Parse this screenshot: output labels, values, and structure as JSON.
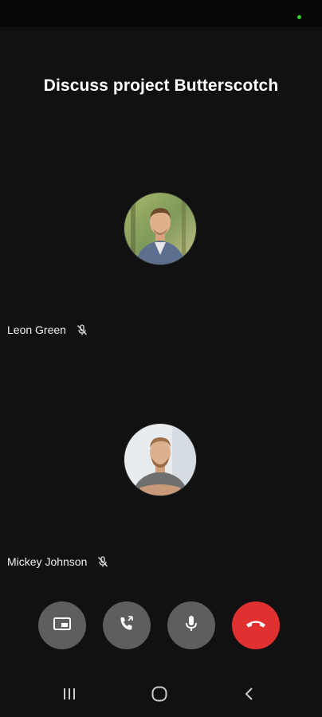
{
  "meeting": {
    "title": "Discuss project Butterscotch"
  },
  "participants": [
    {
      "name": "Leon Green",
      "muted": true,
      "avatar_icon": "person-avatar-icon"
    },
    {
      "name": "Mickey Johnson",
      "muted": true,
      "avatar_icon": "person-avatar-icon"
    }
  ],
  "controls": [
    {
      "name": "picture-in-picture",
      "icon": "pip-icon"
    },
    {
      "name": "switch-call",
      "icon": "phone-switch-icon"
    },
    {
      "name": "microphone",
      "icon": "microphone-icon"
    },
    {
      "name": "end-call",
      "icon": "hang-up-icon",
      "color": "#e03030"
    }
  ],
  "colors": {
    "background": "#111111",
    "button": "#5e5e5e",
    "end_call": "#e03030",
    "status_dot": "#2bd32b"
  },
  "nav": [
    "recent-apps-icon",
    "home-icon",
    "back-icon"
  ]
}
